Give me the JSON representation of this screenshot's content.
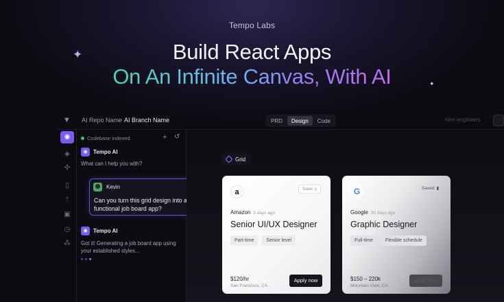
{
  "hero": {
    "brand": "Tempo Labs",
    "headline": "Build React Apps",
    "subline": "On An Infinite Canvas, With AI"
  },
  "topbar": {
    "repo": "AI Repo Name",
    "separator": "›",
    "branch": "AI Branch Name",
    "tabs": [
      "PRD",
      "Design",
      "Code"
    ],
    "active_tab": "Design",
    "hire": "Hire engineers"
  },
  "chat": {
    "status": "Codebase indexed",
    "assistant_name": "Tempo AI",
    "greeting": "What can I help you with?",
    "user_name": "Kevin",
    "user_message": "Can you turn this grid design into a functional job board app?",
    "reply": "Got it! Generating a job board app using your established styles..."
  },
  "canvas": {
    "frame_label": "Grid",
    "cards": [
      {
        "logo": "a",
        "saved": "Save",
        "company": "Amazon",
        "ago": "5 days ago",
        "role": "Senior UI/UX Designer",
        "tags": [
          "Part-time",
          "Senior level"
        ],
        "pay": "$120/hr",
        "location": "San Francisco, CA",
        "cta": "Apply now"
      },
      {
        "logo": "G",
        "saved": "Saved",
        "company": "Google",
        "ago": "30 days ago",
        "role": "Graphic Designer",
        "tags": [
          "Full-time",
          "Flexible schedule"
        ],
        "pay": "$150 – 220k",
        "location": "Mountain View, CA",
        "cta": "Apply now"
      }
    ]
  },
  "colors": {
    "accent": "#7b5cf0",
    "background": "#0c0b12",
    "gradient_start": "#4fd6b0",
    "gradient_end": "#c06cf0"
  }
}
